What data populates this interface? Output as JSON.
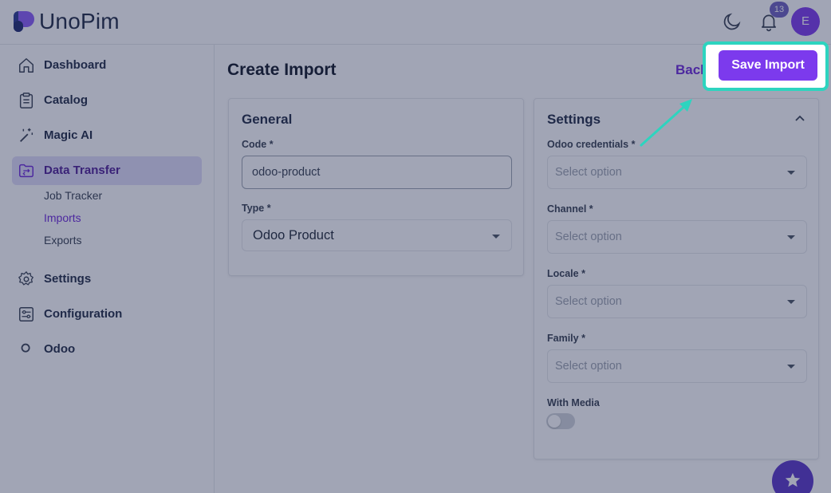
{
  "app": {
    "logo_text": "UnoPim"
  },
  "header": {
    "notification_count": "13",
    "avatar_initial": "E"
  },
  "sidebar": {
    "items": [
      {
        "label": "Dashboard",
        "icon": "home-icon"
      },
      {
        "label": "Catalog",
        "icon": "clipboard-icon"
      },
      {
        "label": "Magic AI",
        "icon": "magic-wand-icon"
      },
      {
        "label": "Data Transfer",
        "icon": "transfer-icon",
        "active": true
      },
      {
        "label": "Settings",
        "icon": "gear-icon"
      },
      {
        "label": "Configuration",
        "icon": "sliders-icon"
      },
      {
        "label": "Odoo",
        "icon": "circle-icon"
      }
    ],
    "sub_items": [
      {
        "label": "Job Tracker"
      },
      {
        "label": "Imports",
        "active": true
      },
      {
        "label": "Exports"
      }
    ]
  },
  "main": {
    "title": "Create Import",
    "back_label": "Back",
    "save_label": "Save Import",
    "general": {
      "title": "General",
      "code_label": "Code *",
      "code_value": "odoo-product",
      "type_label": "Type *",
      "type_value": "Odoo Product"
    },
    "settings": {
      "title": "Settings",
      "fields": [
        {
          "label": "Odoo credentials *",
          "placeholder": "Select option"
        },
        {
          "label": "Channel *",
          "placeholder": "Select option"
        },
        {
          "label": "Locale *",
          "placeholder": "Select option"
        },
        {
          "label": "Family *",
          "placeholder": "Select option"
        }
      ],
      "media_label": "With Media",
      "media_enabled": false
    }
  },
  "colors": {
    "accent": "#7c3aed",
    "highlight": "#2dd4bf",
    "overlay": "#1f294f"
  }
}
